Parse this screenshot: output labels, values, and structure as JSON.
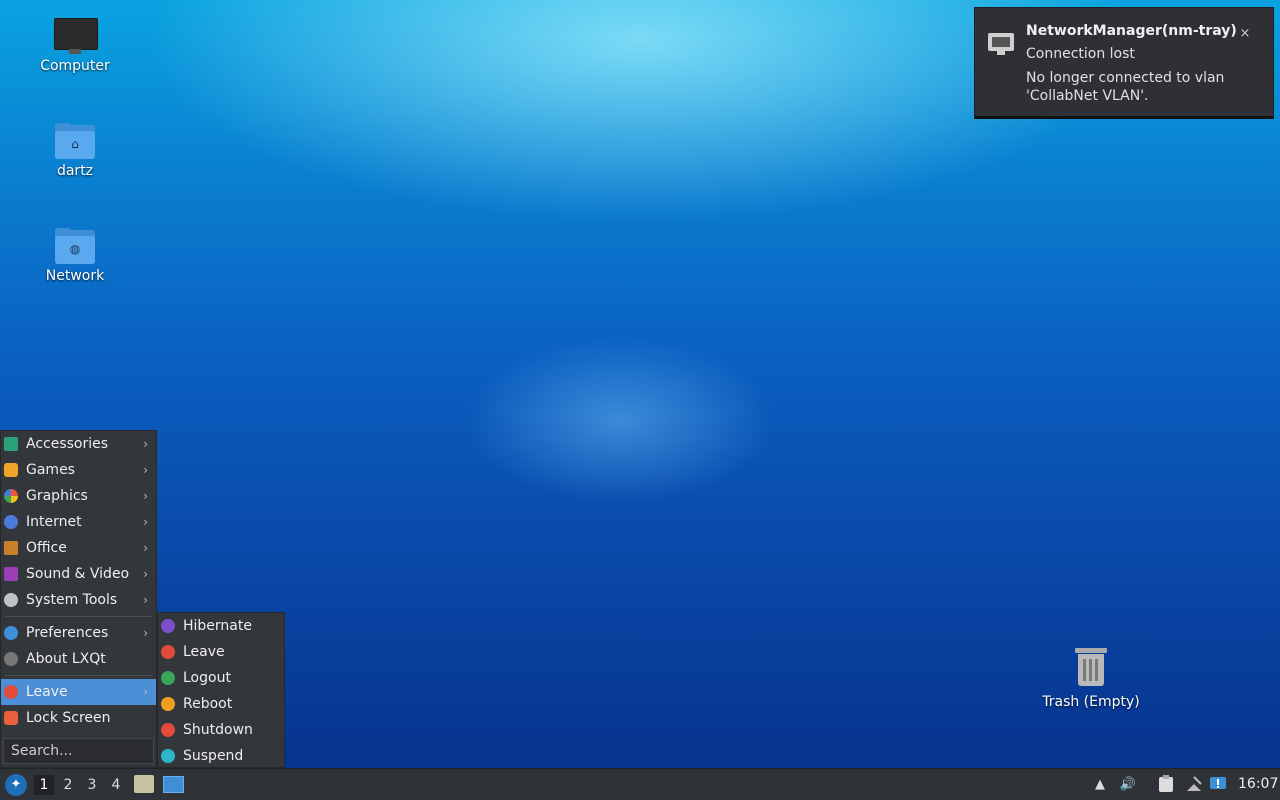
{
  "desktop": {
    "icons": [
      {
        "label": "Computer"
      },
      {
        "label": "dartz"
      },
      {
        "label": "Network"
      }
    ],
    "trash_label": "Trash (Empty)"
  },
  "notification": {
    "title": "NetworkManager(nm-tray)",
    "subtitle": "Connection lost",
    "body": "No longer connected to vlan 'CollabNet VLAN'.",
    "close": "×"
  },
  "menu": {
    "categories": [
      {
        "label": "Accessories",
        "color": "#2ba37a"
      },
      {
        "label": "Games",
        "color": "#f0a52a"
      },
      {
        "label": "Graphics",
        "color": "#e8553c"
      },
      {
        "label": "Internet",
        "color": "#4a7bd8"
      },
      {
        "label": "Office",
        "color": "#c8812a"
      },
      {
        "label": "Sound & Video",
        "color": "#9b3fb5"
      },
      {
        "label": "System Tools",
        "color": "#bfc3c8"
      }
    ],
    "extra": [
      {
        "label": "Preferences",
        "color": "#3d8fd6"
      },
      {
        "label": "About LXQt",
        "color": "#777"
      }
    ],
    "session": [
      {
        "label": "Leave",
        "color": "#e14b3b"
      },
      {
        "label": "Lock Screen",
        "color": "#e8603c"
      }
    ],
    "search_placeholder": "Search..."
  },
  "submenu": {
    "items": [
      {
        "label": "Hibernate",
        "color": "#7b4fc8"
      },
      {
        "label": "Leave",
        "color": "#e14b3b"
      },
      {
        "label": "Logout",
        "color": "#3ba55c"
      },
      {
        "label": "Reboot",
        "color": "#f0a020"
      },
      {
        "label": "Shutdown",
        "color": "#e14b3b"
      },
      {
        "label": "Suspend",
        "color": "#2eb5c8"
      }
    ]
  },
  "taskbar": {
    "workspaces": [
      "1",
      "2",
      "3",
      "4"
    ],
    "clock": "16:07"
  },
  "icons": {
    "arrow": "›",
    "volume": "🔊",
    "up": "▲"
  }
}
